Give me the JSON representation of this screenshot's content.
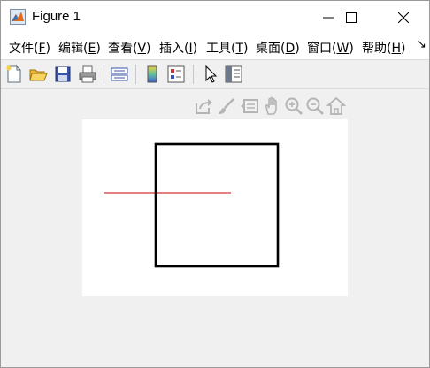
{
  "window": {
    "title": "Figure 1"
  },
  "titlebar": {
    "controls": [
      {
        "name": "minimize",
        "icon": "minimize-icon"
      },
      {
        "name": "maximize",
        "icon": "maximize-icon"
      },
      {
        "name": "close",
        "icon": "close-icon"
      }
    ]
  },
  "menubar": {
    "items": [
      {
        "label": "文件(",
        "key": "F",
        "suffix": ")"
      },
      {
        "label": "编辑(",
        "key": "E",
        "suffix": ")"
      },
      {
        "label": "查看(",
        "key": "V",
        "suffix": ")"
      },
      {
        "label": "插入(",
        "key": "I",
        "suffix": ")"
      },
      {
        "label": "工具(",
        "key": "T",
        "suffix": ")"
      },
      {
        "label": "桌面(",
        "key": "D",
        "suffix": ")"
      },
      {
        "label": "窗口(",
        "key": "W",
        "suffix": ")"
      },
      {
        "label": "帮助(",
        "key": "H",
        "suffix": ")"
      }
    ],
    "overflow": "↘"
  },
  "toolbar": {
    "buttons": [
      "new-figure-icon",
      "open-file-icon",
      "save-icon",
      "print-icon",
      "link-plot-icon",
      "insert-colorbar-icon",
      "insert-legend-icon",
      "edit-plot-arrow-icon",
      "property-inspector-icon"
    ]
  },
  "axes_toolbar": {
    "buttons": [
      "export-icon",
      "brush-icon",
      "data-tips-icon",
      "pan-icon",
      "zoom-in-icon",
      "zoom-out-icon",
      "home-icon"
    ]
  },
  "colors": {
    "line": "#cc0000",
    "square": "#000000",
    "axes_bg": "#ffffff"
  }
}
